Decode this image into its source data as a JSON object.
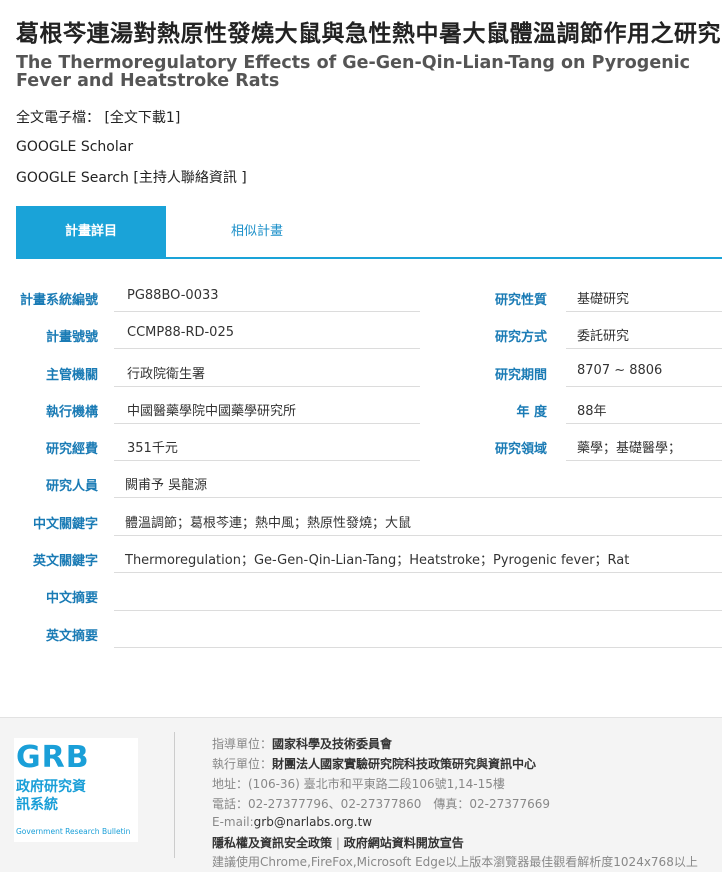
{
  "title_zh": "葛根芩連湯對熱原性發燒大鼠與急性熱中暑大鼠體溫調節作用之研究",
  "title_en": "The Thermoregulatory Effects of Ge-Gen-Qin-Lian-Tang on Pyrogenic Fever and Heatstroke Rats",
  "fulltext": {
    "label": "全文電子檔：",
    "link": "[全文下載1]"
  },
  "google_scholar": "GOOGLE Scholar",
  "google_search": {
    "label": "GOOGLE Search",
    "link": "[主持人聯絡資訊 ]"
  },
  "tabs": [
    {
      "label": "計畫詳目",
      "active": true
    },
    {
      "label": "相似計畫",
      "active": false
    }
  ],
  "details": {
    "plan_system_no": {
      "label": "計畫系統編號",
      "value": "PG88BO-0033"
    },
    "research_nature": {
      "label": "研究性質",
      "value": "基礎研究"
    },
    "plan_no": {
      "label": "計畫號號",
      "value": "CCMP88-RD-025"
    },
    "research_method": {
      "label": "研究方式",
      "value": "委託研究"
    },
    "authority": {
      "label": "主管機關",
      "value": "行政院衛生署"
    },
    "period": {
      "label": "研究期間",
      "value": "8707 ~ 8806"
    },
    "executor": {
      "label": "執行機構",
      "value": "中國醫藥學院中國藥學研究所"
    },
    "year": {
      "label": "年 度",
      "value": "88年"
    },
    "funding": {
      "label": "研究經費",
      "value": "351千元"
    },
    "field": {
      "label": "研究領域",
      "value": "藥學；基礎醫學；"
    },
    "researchers": {
      "label": "研究人員",
      "value": "闕甫予  吳龍源"
    },
    "keywords_zh": {
      "label": "中文關鍵字",
      "value": "體溫調節；葛根芩連；熱中風；熱原性發燒；大鼠"
    },
    "keywords_en": {
      "label": "英文關鍵字",
      "value": "Thermoregulation；Ge-Gen-Qin-Lian-Tang；Heatstroke；Pyrogenic fever；Rat"
    },
    "abstract_zh": {
      "label": "中文摘要",
      "value": ""
    },
    "abstract_en": {
      "label": "英文摘要",
      "value": ""
    }
  },
  "footer": {
    "logo": {
      "name": "GRB",
      "zh": "政府研究資訊系統",
      "en": "Government Research Bulletin"
    },
    "supervisor": {
      "label": "指導單位：",
      "value": "國家科學及技術委員會"
    },
    "executor": {
      "label": "執行單位：",
      "value": "財團法人國家實驗研究院科技政策研究與資訊中心"
    },
    "address": "地址：(106-36) 臺北市和平東路二段106號1,14-15樓",
    "phone": "電話：02-27377796、02-27377860　傳真：02-27377669",
    "email": {
      "label": "E-mail:",
      "value": "grb@narlabs.org.tw"
    },
    "privacy": "隱私權及資訊安全政策",
    "separator": "|",
    "open_data": "政府網站資料開放宣告",
    "browser_note": "建議使用Chrome,FireFox,Microsoft Edge以上版本瀏覽器最佳觀看解析度1024x768以上"
  }
}
